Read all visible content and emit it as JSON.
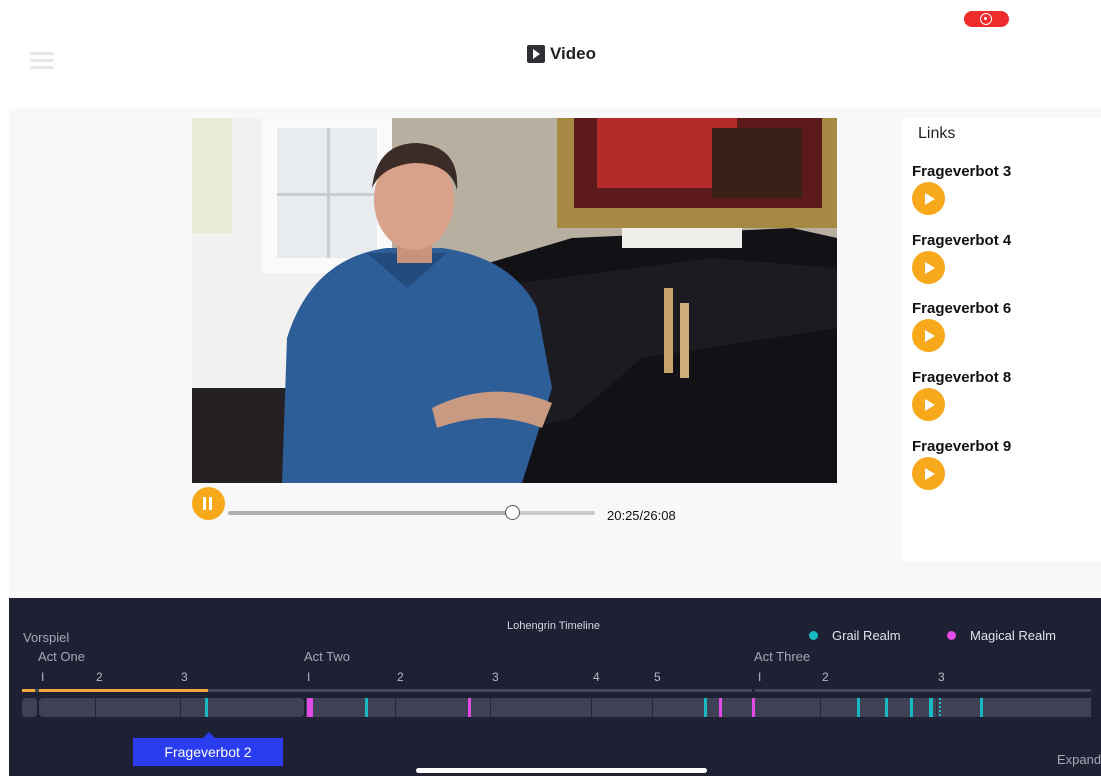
{
  "header": {
    "title": "Video"
  },
  "player": {
    "time": "20:25/26:08",
    "progress": 0.77,
    "state": "playing"
  },
  "links": {
    "title": "Links",
    "items": [
      {
        "label": "Frageverbot 3"
      },
      {
        "label": "Frageverbot 4"
      },
      {
        "label": "Frageverbot 6"
      },
      {
        "label": "Frageverbot 8"
      },
      {
        "label": "Frageverbot 9"
      }
    ]
  },
  "timeline": {
    "title": "Lohengrin Timeline",
    "legend": [
      {
        "label": "Grail Realm",
        "color": "#16b9c4"
      },
      {
        "label": "Magical Realm",
        "color": "#e24ce6"
      }
    ],
    "prelude": "Vorspiel",
    "acts": [
      {
        "label": "Act One",
        "scenes": [
          "I",
          "2",
          "3"
        ]
      },
      {
        "label": "Act Two",
        "scenes": [
          "I",
          "2",
          "3",
          "4",
          "5"
        ]
      },
      {
        "label": "Act Three",
        "scenes": [
          "I",
          "2",
          "3"
        ]
      }
    ],
    "selected": "Frageverbot 2",
    "expand_label": "Expand",
    "progress_color": "#f0a93a"
  }
}
